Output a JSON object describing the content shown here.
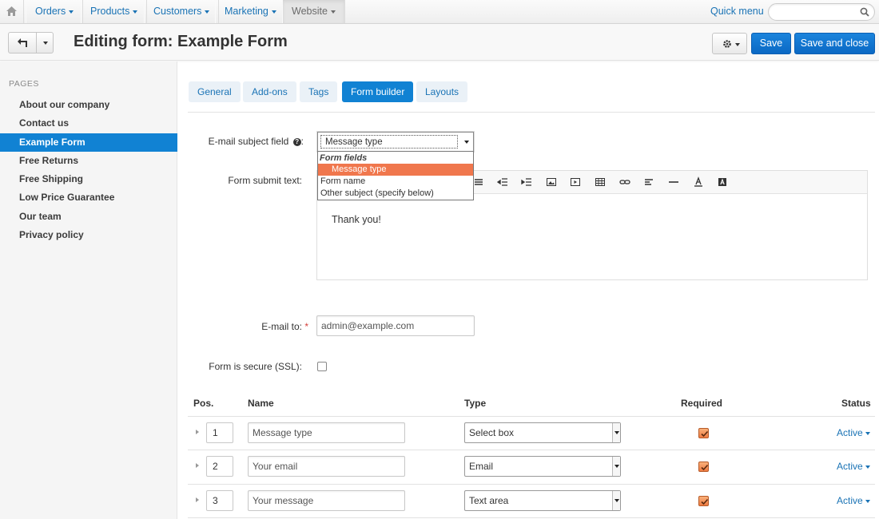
{
  "topnav": {
    "items": [
      {
        "label": "Orders"
      },
      {
        "label": "Products"
      },
      {
        "label": "Customers"
      },
      {
        "label": "Marketing"
      },
      {
        "label": "Website"
      }
    ],
    "quick_menu": "Quick menu",
    "search_placeholder": ""
  },
  "header": {
    "title": "Editing form: Example Form",
    "save_label": "Save",
    "save_close_label": "Save and close"
  },
  "sidebar": {
    "heading": "PAGES",
    "items": [
      {
        "label": "About our company"
      },
      {
        "label": "Contact us"
      },
      {
        "label": "Example Form",
        "selected": true
      },
      {
        "label": "Free Returns"
      },
      {
        "label": "Free Shipping"
      },
      {
        "label": "Low Price Guarantee"
      },
      {
        "label": "Our team"
      },
      {
        "label": "Privacy policy"
      }
    ]
  },
  "tabs": [
    {
      "label": "General"
    },
    {
      "label": "Add-ons"
    },
    {
      "label": "Tags"
    },
    {
      "label": "Form builder",
      "active": true
    },
    {
      "label": "Layouts"
    }
  ],
  "form": {
    "email_subject_label": "E-mail subject field",
    "email_subject_value": "Message type",
    "dropdown": {
      "group_label": "Form fields",
      "options": [
        "Message type",
        "Form name",
        "Other subject (specify below)"
      ],
      "selected": "Message type"
    },
    "submit_text_label": "Form submit text:",
    "submit_text_value": "Thank you!",
    "email_to_label": "E-mail to:",
    "email_to_value": "admin@example.com",
    "secure_label": "Form is secure (SSL):",
    "secure_checked": false
  },
  "table": {
    "headers": {
      "pos": "Pos.",
      "name": "Name",
      "type": "Type",
      "required": "Required",
      "status": "Status"
    },
    "rows": [
      {
        "pos": "1",
        "name": "Message type",
        "type": "Select box",
        "required": true,
        "status": "Active"
      },
      {
        "pos": "2",
        "name": "Your email",
        "type": "Email",
        "required": true,
        "status": "Active"
      },
      {
        "pos": "3",
        "name": "Your message",
        "type": "Text area",
        "required": true,
        "status": "Active"
      }
    ]
  },
  "colors": {
    "accent": "#1182d3",
    "link": "#1a73b5",
    "dropdown_highlight": "#f0774d",
    "required_star": "#d43f3a"
  },
  "icons": {
    "home": "home-icon",
    "search": "search-icon",
    "back": "back-arrow-icon",
    "gear": "gear-icon",
    "help": "question-circle-icon"
  }
}
